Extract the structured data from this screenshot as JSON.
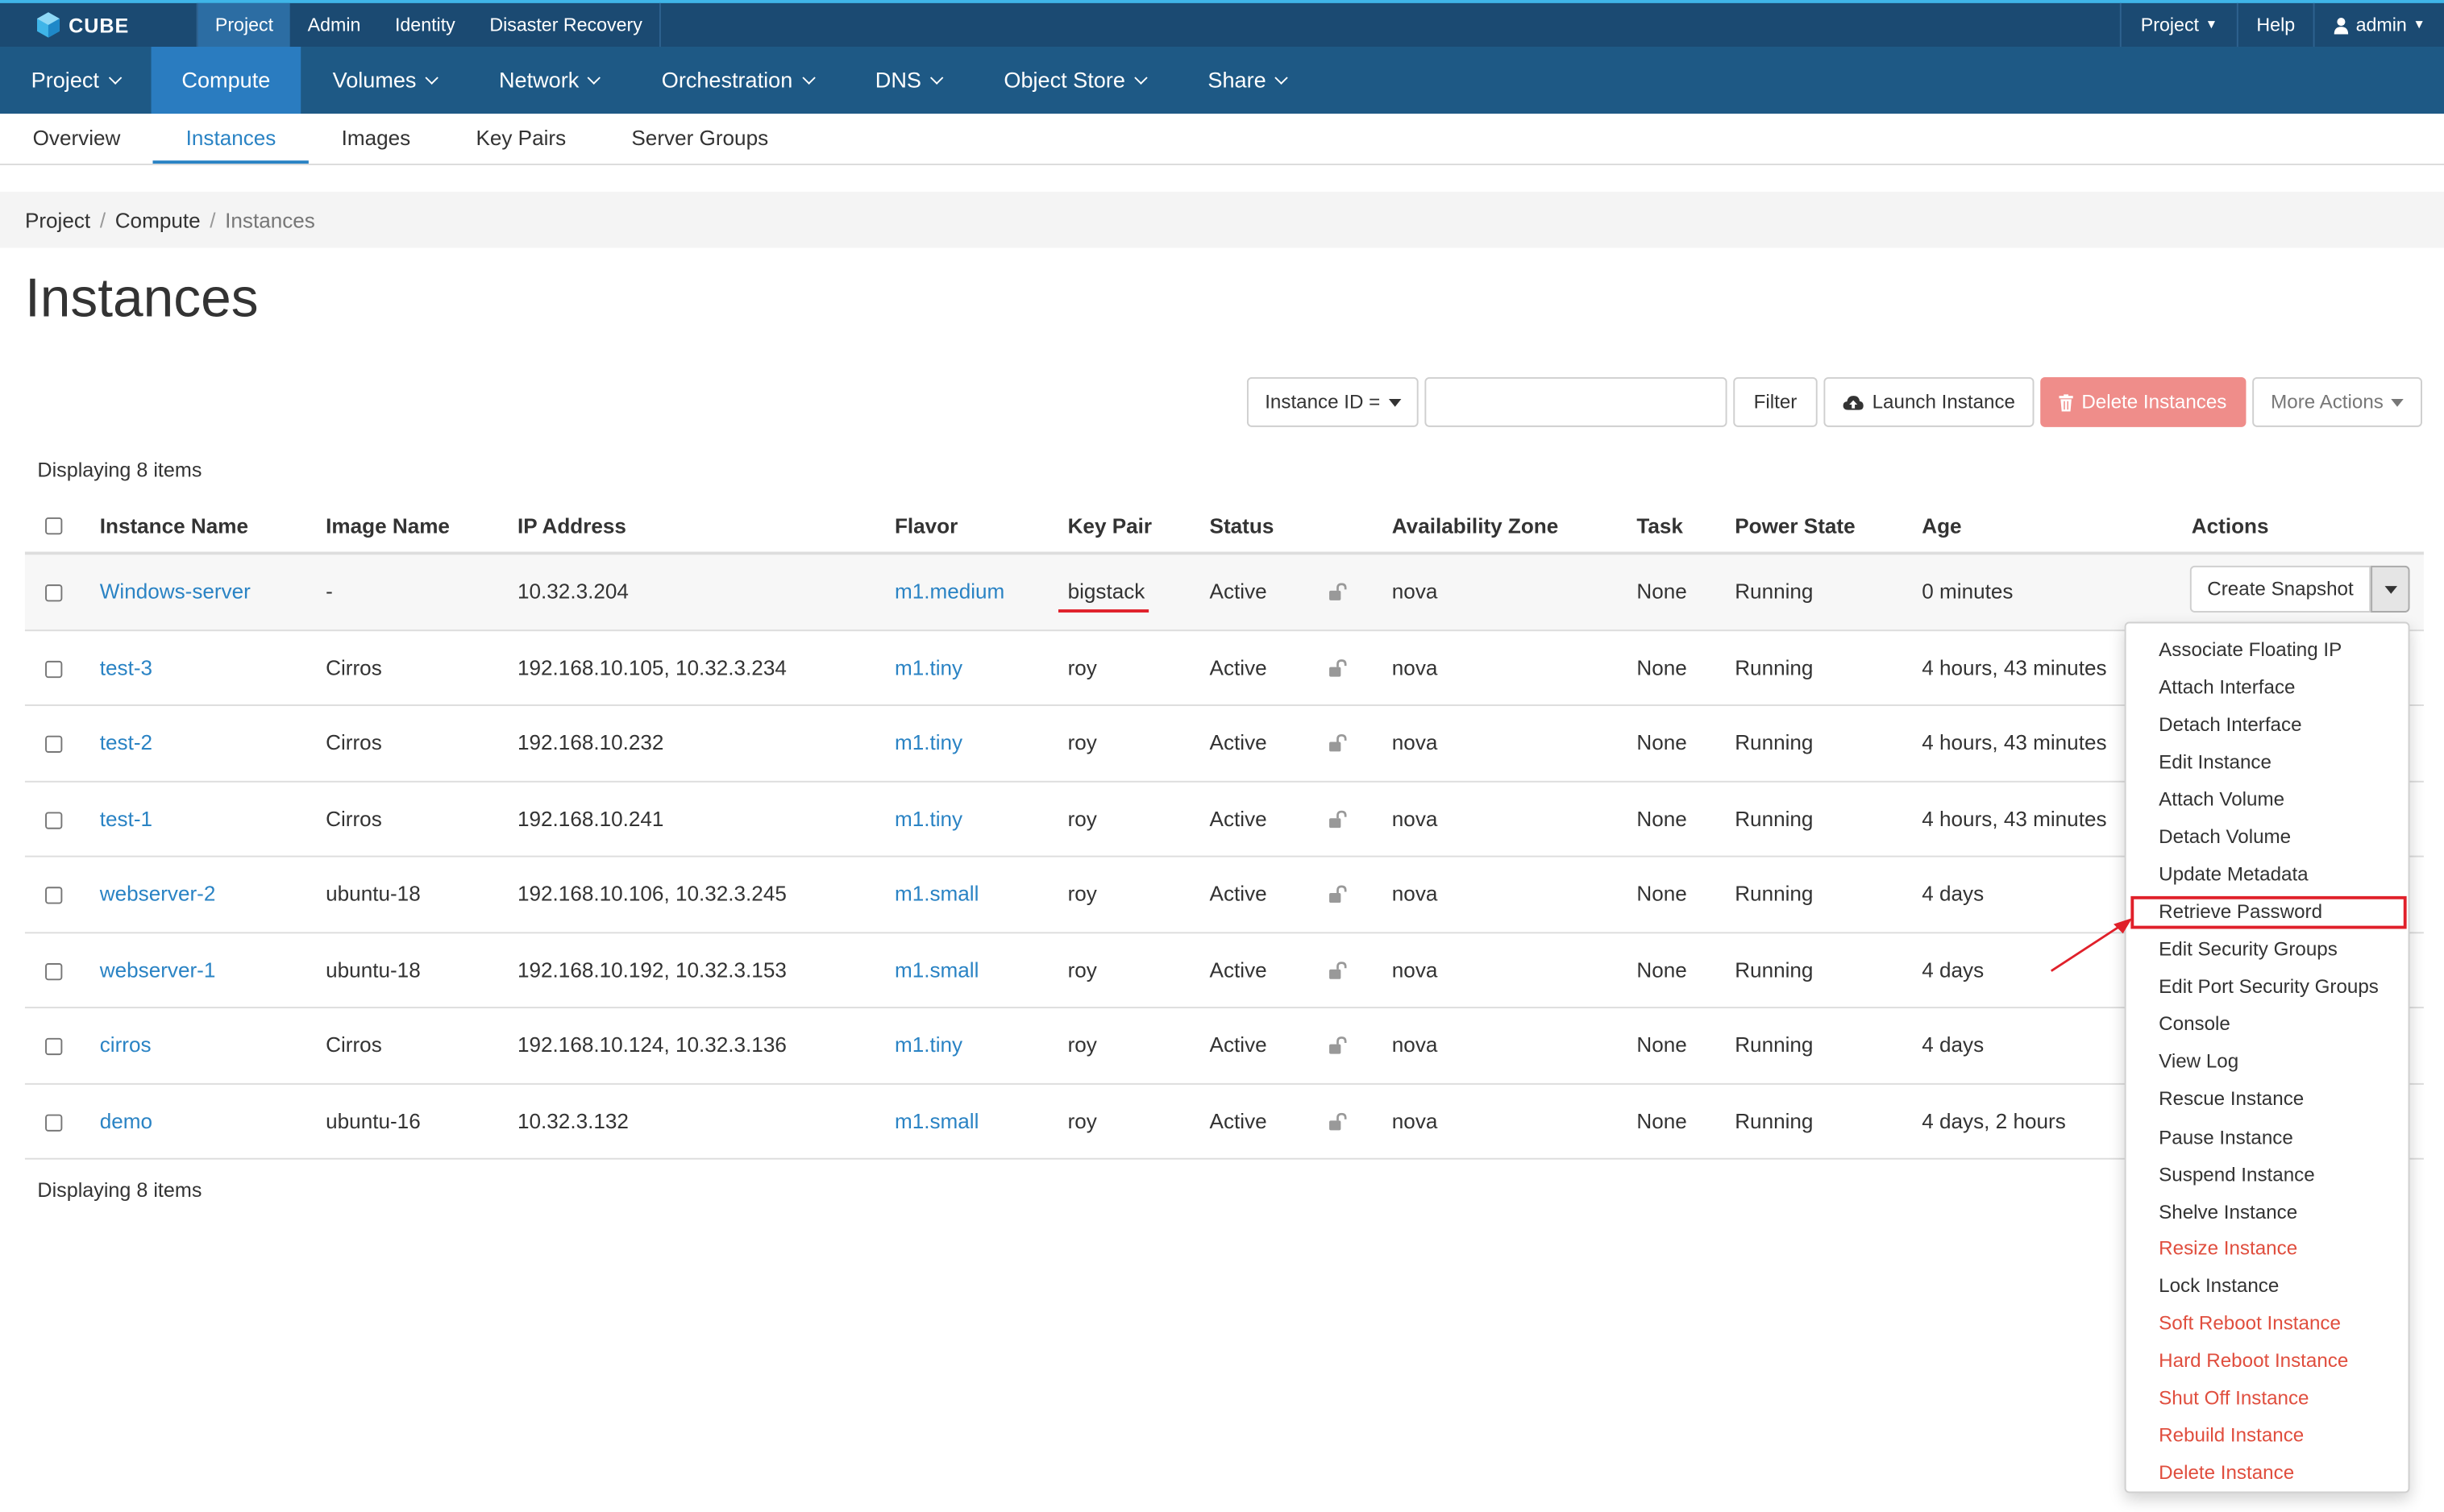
{
  "app": {
    "logo_text": "CUBE",
    "top_tabs": [
      "Project",
      "Admin",
      "Identity",
      "Disaster Recovery"
    ],
    "top_right": {
      "project": "Project",
      "help": "Help",
      "user": "admin"
    }
  },
  "main_nav": [
    "Project",
    "Compute",
    "Volumes",
    "Network",
    "Orchestration",
    "DNS",
    "Object Store",
    "Share"
  ],
  "sub_nav": [
    "Overview",
    "Instances",
    "Images",
    "Key Pairs",
    "Server Groups"
  ],
  "breadcrumb": [
    "Project",
    "Compute",
    "Instances"
  ],
  "page_title": "Instances",
  "toolbar": {
    "filter_field": "Instance ID =",
    "filter_value": "",
    "filter_button": "Filter",
    "launch_button": "Launch Instance",
    "delete_button": "Delete Instances",
    "more_actions": "More Actions"
  },
  "display_count": "Displaying 8 items",
  "table": {
    "columns": [
      "Instance Name",
      "Image Name",
      "IP Address",
      "Flavor",
      "Key Pair",
      "Status",
      "Availability Zone",
      "Task",
      "Power State",
      "Age",
      "Actions"
    ],
    "rows": [
      {
        "name": "Windows-server",
        "image": "-",
        "ip": "10.32.3.204",
        "flavor": "m1.medium",
        "keypair": "bigstack",
        "status": "Active",
        "zone": "nova",
        "task": "None",
        "power": "Running",
        "age": "0 minutes",
        "action": "Create Snapshot"
      },
      {
        "name": "test-3",
        "image": "Cirros",
        "ip": "192.168.10.105, 10.32.3.234",
        "flavor": "m1.tiny",
        "keypair": "roy",
        "status": "Active",
        "zone": "nova",
        "task": "None",
        "power": "Running",
        "age": "4 hours, 43 minutes"
      },
      {
        "name": "test-2",
        "image": "Cirros",
        "ip": "192.168.10.232",
        "flavor": "m1.tiny",
        "keypair": "roy",
        "status": "Active",
        "zone": "nova",
        "task": "None",
        "power": "Running",
        "age": "4 hours, 43 minutes"
      },
      {
        "name": "test-1",
        "image": "Cirros",
        "ip": "192.168.10.241",
        "flavor": "m1.tiny",
        "keypair": "roy",
        "status": "Active",
        "zone": "nova",
        "task": "None",
        "power": "Running",
        "age": "4 hours, 43 minutes"
      },
      {
        "name": "webserver-2",
        "image": "ubuntu-18",
        "ip": "192.168.10.106, 10.32.3.245",
        "flavor": "m1.small",
        "keypair": "roy",
        "status": "Active",
        "zone": "nova",
        "task": "None",
        "power": "Running",
        "age": "4 days"
      },
      {
        "name": "webserver-1",
        "image": "ubuntu-18",
        "ip": "192.168.10.192, 10.32.3.153",
        "flavor": "m1.small",
        "keypair": "roy",
        "status": "Active",
        "zone": "nova",
        "task": "None",
        "power": "Running",
        "age": "4 days"
      },
      {
        "name": "cirros",
        "image": "Cirros",
        "ip": "192.168.10.124, 10.32.3.136",
        "flavor": "m1.tiny",
        "keypair": "roy",
        "status": "Active",
        "zone": "nova",
        "task": "None",
        "power": "Running",
        "age": "4 days"
      },
      {
        "name": "demo",
        "image": "ubuntu-16",
        "ip": "10.32.3.132",
        "flavor": "m1.small",
        "keypair": "roy",
        "status": "Active",
        "zone": "nova",
        "task": "None",
        "power": "Running",
        "age": "4 days, 2 hours"
      }
    ]
  },
  "actions_menu": [
    {
      "label": "Associate Floating IP",
      "danger": false
    },
    {
      "label": "Attach Interface",
      "danger": false
    },
    {
      "label": "Detach Interface",
      "danger": false
    },
    {
      "label": "Edit Instance",
      "danger": false
    },
    {
      "label": "Attach Volume",
      "danger": false
    },
    {
      "label": "Detach Volume",
      "danger": false
    },
    {
      "label": "Update Metadata",
      "danger": false
    },
    {
      "label": "Retrieve Password",
      "danger": false
    },
    {
      "label": "Edit Security Groups",
      "danger": false
    },
    {
      "label": "Edit Port Security Groups",
      "danger": false
    },
    {
      "label": "Console",
      "danger": false
    },
    {
      "label": "View Log",
      "danger": false
    },
    {
      "label": "Rescue Instance",
      "danger": false
    },
    {
      "label": "Pause Instance",
      "danger": false
    },
    {
      "label": "Suspend Instance",
      "danger": false
    },
    {
      "label": "Shelve Instance",
      "danger": false
    },
    {
      "label": "Resize Instance",
      "danger": true
    },
    {
      "label": "Lock Instance",
      "danger": false
    },
    {
      "label": "Soft Reboot Instance",
      "danger": true
    },
    {
      "label": "Hard Reboot Instance",
      "danger": true
    },
    {
      "label": "Shut Off Instance",
      "danger": true
    },
    {
      "label": "Rebuild Instance",
      "danger": true
    },
    {
      "label": "Delete Instance",
      "danger": true
    }
  ],
  "colors": {
    "topbar": "#1b4a72",
    "mainnav": "#1e5985",
    "mainnav_active": "#2a7cc0",
    "link": "#2a83c4",
    "danger": "#e04e3e",
    "annotation": "#e0202a"
  }
}
